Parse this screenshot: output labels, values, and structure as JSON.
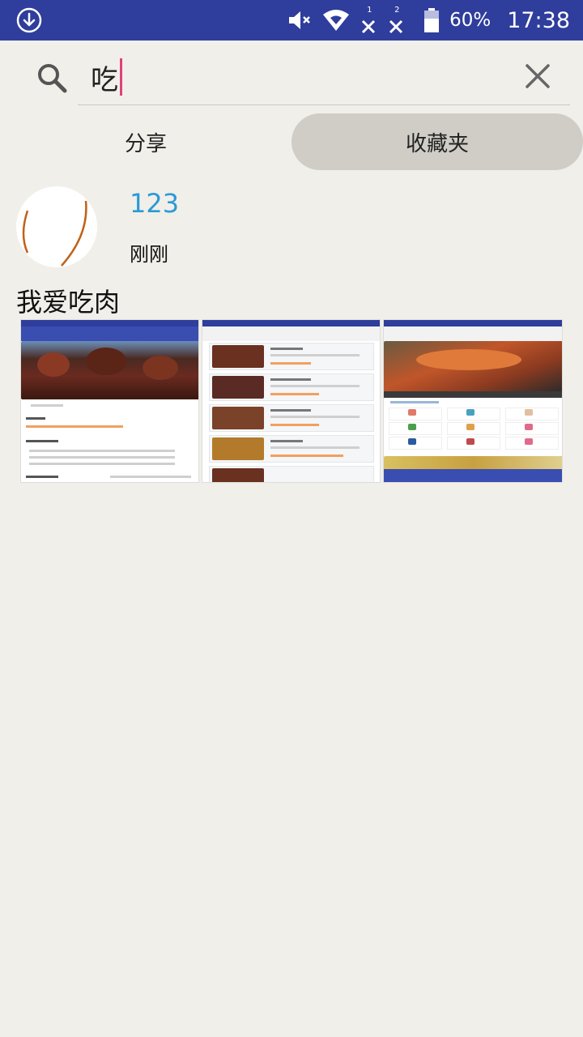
{
  "status_bar": {
    "download_icon": "download-circle-icon",
    "mute_icon": "volume-mute-icon",
    "wifi_icon": "wifi-icon",
    "sim1_label": "1",
    "sim2_label": "2",
    "battery_icon": "battery-icon",
    "battery_percent": "60%",
    "time": "17:38"
  },
  "search": {
    "query": "吃",
    "search_icon": "search-icon",
    "clear_icon": "close-icon"
  },
  "tabs": [
    {
      "label": "分享",
      "selected": false
    },
    {
      "label": "收藏夹",
      "selected": true
    }
  ],
  "post": {
    "username": "123",
    "time": "刚刚",
    "text": "我爱吃肉",
    "images": [
      {
        "icon": "recipe-detail-screenshot-thumbnail"
      },
      {
        "icon": "recipe-list-screenshot-thumbnail"
      },
      {
        "icon": "recipe-home-screenshot-thumbnail"
      }
    ]
  },
  "colors": {
    "status_bar": "#2f3d9c",
    "background": "#f0efe9",
    "accent_username": "#2a9ad6",
    "selected_tab": "#cfcdc6",
    "caret": "#e0417a"
  }
}
